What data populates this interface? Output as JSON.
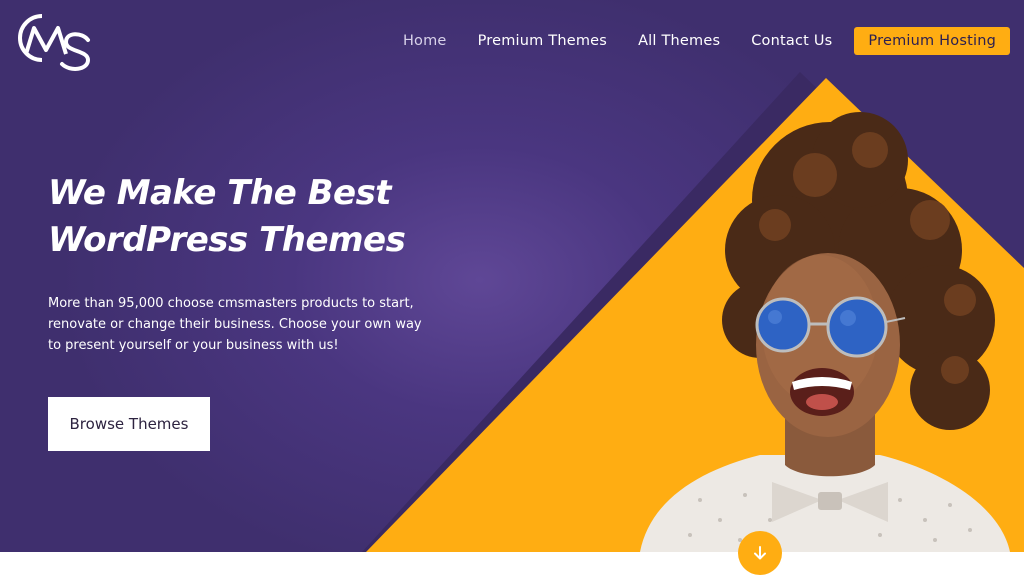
{
  "brand": {
    "logo_text": "CMS"
  },
  "nav": {
    "items": [
      {
        "label": "Home"
      },
      {
        "label": "Premium Themes"
      },
      {
        "label": "All Themes"
      },
      {
        "label": "Contact Us"
      }
    ],
    "cta_label": "Premium Hosting"
  },
  "hero": {
    "headline_line1": "We Make The Best",
    "headline_line2": "WordPress Themes",
    "subtext_line1": "More than 95,000 choose cmsmasters products to start,",
    "subtext_line2": "renovate or change their business. Choose your own way",
    "subtext_line3": "to present yourself or your business with us!",
    "button_label": "Browse Themes"
  },
  "colors": {
    "background_purple": "#4a3680",
    "accent_orange": "#ffad12",
    "button_white": "#ffffff"
  },
  "icons": {
    "scroll": "arrow-down-icon",
    "logo": "cms-logo-icon"
  }
}
